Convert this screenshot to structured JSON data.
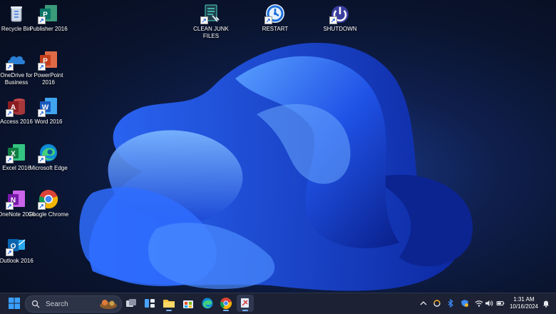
{
  "desktop": {
    "icons_left": [
      {
        "label": "Recycle Bin"
      },
      {
        "label": "Publisher 2016"
      },
      {
        "label": "OneDrive for Business"
      },
      {
        "label": "PowerPoint 2016"
      },
      {
        "label": "Access 2016"
      },
      {
        "label": "Word 2016"
      },
      {
        "label": "Excel 2016"
      },
      {
        "label": "Microsoft Edge"
      },
      {
        "label": "OneNote 2016"
      },
      {
        "label": "Google Chrome"
      },
      {
        "label": "Outlook 2016"
      }
    ],
    "icons_top": [
      {
        "label": "CLEAN JUNK FILES"
      },
      {
        "label": "RESTART"
      },
      {
        "label": "SHUTDOWN"
      }
    ]
  },
  "taskbar": {
    "search_placeholder": "Search",
    "clock_time": "1:31 AM",
    "clock_date": "10/16/2024"
  },
  "colors": {
    "taskbar_bg": "#1c2233",
    "accent": "#3b82f6"
  }
}
